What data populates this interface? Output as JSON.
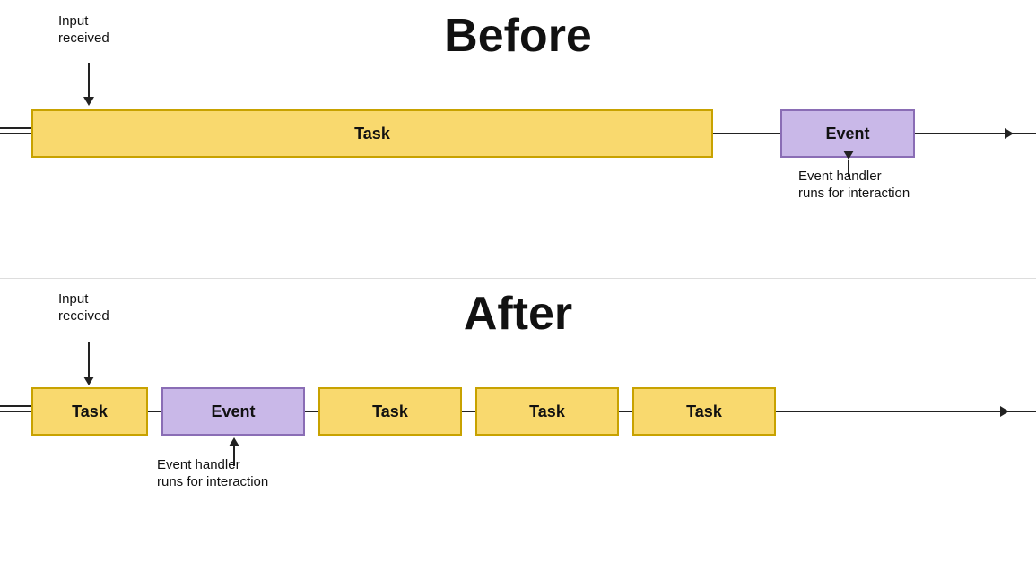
{
  "before": {
    "title": "Before",
    "input_label": "Input\nreceived",
    "task_label": "Task",
    "event_label": "Event",
    "event_handler_label": "Event handler\nruns for interaction"
  },
  "after": {
    "title": "After",
    "input_label": "Input\nreceived",
    "task1_label": "Task",
    "event_label": "Event",
    "task2_label": "Task",
    "task3_label": "Task",
    "task4_label": "Task",
    "event_handler_label": "Event handler\nruns for interaction"
  }
}
